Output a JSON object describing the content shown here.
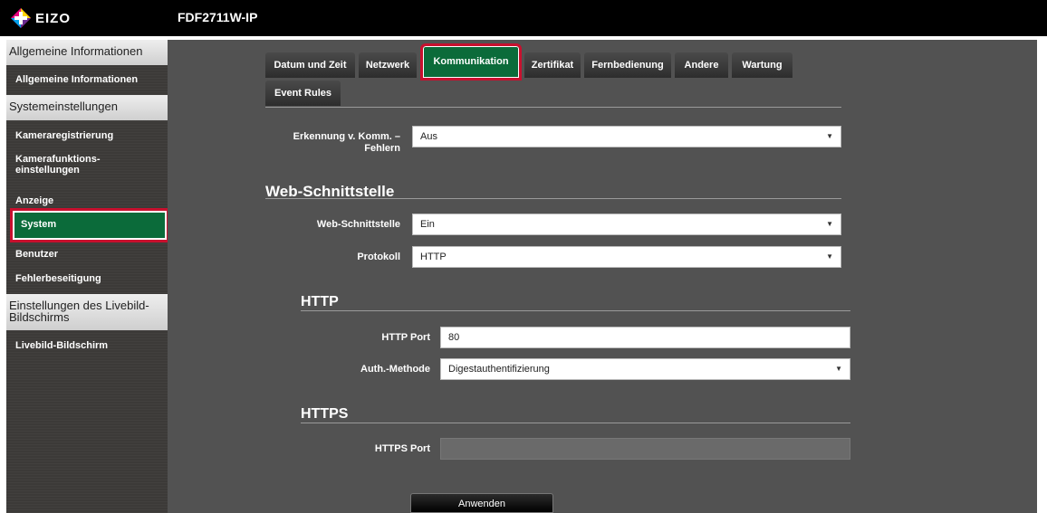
{
  "header": {
    "logo_text": "EIZO",
    "device_title": "FDF2711W-IP"
  },
  "sidebar": {
    "sections": [
      {
        "label": "Allgemeine Informationen"
      },
      {
        "label": "Systemeinstellungen"
      },
      {
        "label": "Einstellungen des Livebild-Bildschirms"
      }
    ],
    "items": [
      {
        "label": "Allgemeine Informationen"
      },
      {
        "label": "Kameraregistrierung"
      },
      {
        "label": "Kamerafunktions-einstellungen"
      },
      {
        "label": "Anzeige"
      },
      {
        "label": "System",
        "active": true
      },
      {
        "label": "Benutzer"
      },
      {
        "label": "Fehlerbeseitigung"
      },
      {
        "label": "Livebild-Bildschirm"
      }
    ]
  },
  "tabs": [
    {
      "label": "Datum und Zeit"
    },
    {
      "label": "Netzwerk"
    },
    {
      "label": "Kommunikation",
      "active": true
    },
    {
      "label": "Zertifikat"
    },
    {
      "label": "Fernbedienung"
    },
    {
      "label": "Andere"
    },
    {
      "label": "Wartung"
    },
    {
      "label": "Event Rules"
    }
  ],
  "form": {
    "error_detection": {
      "label": "Erkennung v. Komm. – Fehlern",
      "value": "Aus"
    },
    "web_section_title": "Web-Schnittstelle",
    "web_interface": {
      "label": "Web-Schnittstelle",
      "value": "Ein"
    },
    "protocol": {
      "label": "Protokoll",
      "value": "HTTP"
    },
    "http_section_title": "HTTP",
    "http_port": {
      "label": "HTTP Port",
      "value": "80"
    },
    "auth_method": {
      "label": "Auth.-Methode",
      "value": "Digestauthentifizierung"
    },
    "https_section_title": "HTTPS",
    "https_port": {
      "label": "HTTPS Port",
      "value": ""
    },
    "apply_label": "Anwenden"
  },
  "colors": {
    "active_green": "#0b6b3a",
    "highlight_red": "#c8102e",
    "content_bg": "#525252",
    "sidebar_bg": "#3c3a38"
  }
}
